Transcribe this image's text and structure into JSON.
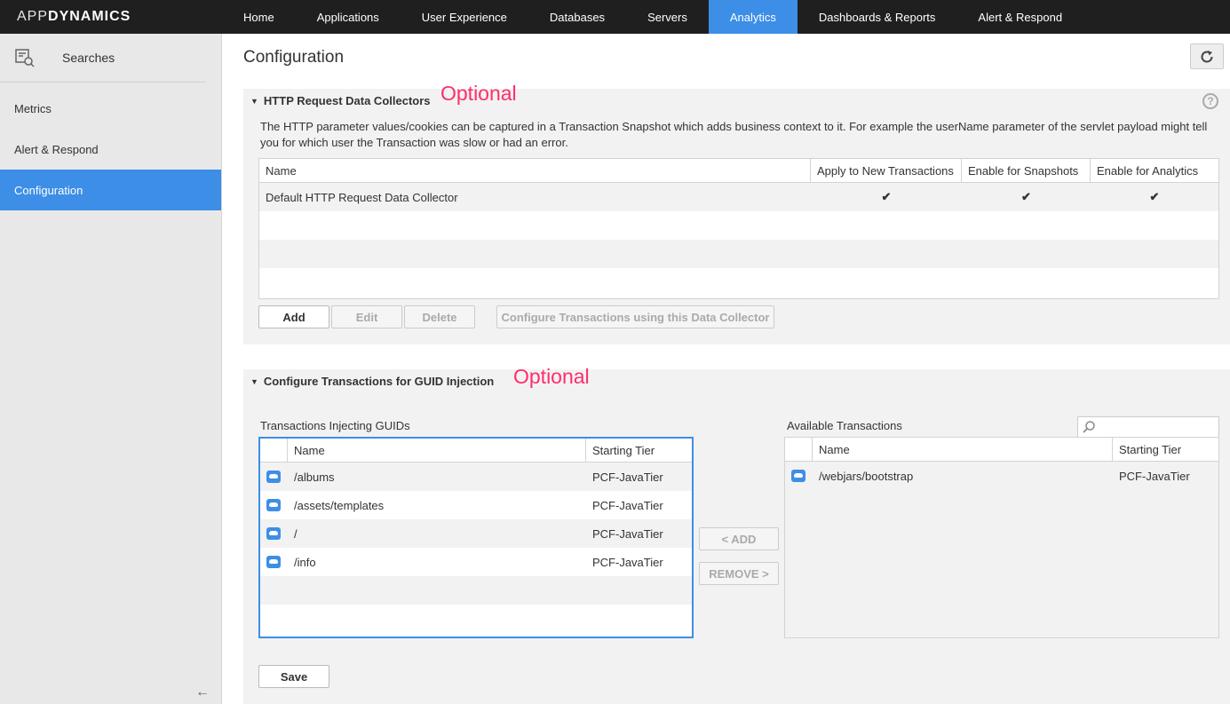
{
  "brand": {
    "app": "APP",
    "dynamics": "DYNAMICS"
  },
  "nav": [
    "Home",
    "Applications",
    "User Experience",
    "Databases",
    "Servers",
    "Analytics",
    "Dashboards & Reports",
    "Alert & Respond"
  ],
  "nav_active": "Analytics",
  "sidebar": {
    "search_label": "Searches",
    "items": [
      "Metrics",
      "Alert & Respond",
      "Configuration"
    ],
    "active": "Configuration"
  },
  "page": {
    "title": "Configuration"
  },
  "http_section": {
    "title": "HTTP Request Data Collectors",
    "optional": "Optional",
    "description": "The HTTP parameter values/cookies can be captured in a Transaction Snapshot which adds business context to it. For example the userName parameter of the servlet payload might tell you for which user the Transaction was slow or had an error.",
    "columns": [
      "Name",
      "Apply to New Transactions",
      "Enable for Snapshots",
      "Enable for Analytics"
    ],
    "rows": [
      {
        "name": "Default HTTP Request Data Collector",
        "apply": true,
        "snapshots": true,
        "analytics": true
      }
    ],
    "buttons": {
      "add": "Add",
      "edit": "Edit",
      "delete": "Delete",
      "configure": "Configure Transactions using this Data Collector"
    }
  },
  "guid_section": {
    "title": "Configure Transactions for GUID Injection",
    "optional": "Optional",
    "injecting_label": "Transactions Injecting GUIDs",
    "available_label": "Available Transactions",
    "columns": [
      "Name",
      "Starting Tier"
    ],
    "injecting": [
      {
        "name": "/albums",
        "tier": "PCF-JavaTier"
      },
      {
        "name": "/assets/templates",
        "tier": "PCF-JavaTier"
      },
      {
        "name": "/",
        "tier": "PCF-JavaTier"
      },
      {
        "name": "/info",
        "tier": "PCF-JavaTier"
      }
    ],
    "available": [
      {
        "name": "/webjars/bootstrap",
        "tier": "PCF-JavaTier"
      }
    ],
    "add_button": "< ADD",
    "remove_button": "REMOVE >",
    "save_button": "Save",
    "search_placeholder": ""
  }
}
